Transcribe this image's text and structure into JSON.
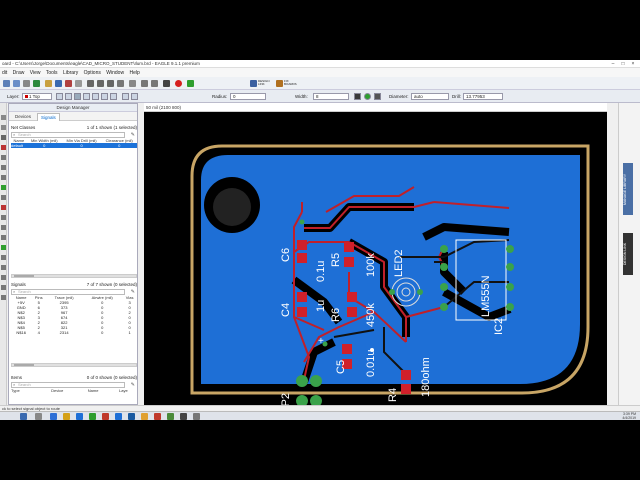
{
  "window": {
    "title": "oard - C:\\Users\\Jorge\\Documents\\eagle\\CAD_MICRO_STUDENT\\Ilum.brd - EAGLE 9.1.1 premium"
  },
  "menu": [
    "dit",
    "Draw",
    "View",
    "Tools",
    "Library",
    "Options",
    "Window",
    "Help"
  ],
  "toolbar": {
    "layer_label": "Layer:",
    "layer_value": "1 Top",
    "radius_label": "Radius:",
    "radius_value": "0",
    "width_label": "Width:",
    "width_value": "8",
    "diameter_label": "Diameter:",
    "diameter_value": "auto",
    "drill_label": "Drill:",
    "drill_value": "13.77953",
    "design_link_label": "DESIGN LINK",
    "fusion_label": "FIX BOARDS"
  },
  "coordinates": "50 mil (2100 800)",
  "design_manager": {
    "title": "Design Manager",
    "tabs": [
      "Devices",
      "Signals"
    ],
    "active_tab": "Signals",
    "net_classes": {
      "header": "Net Classes",
      "count": "1 of 1 shown (1 selected)",
      "search_placeholder": "Search",
      "columns": [
        "Name",
        "Min Width (mil)",
        "Min Via Drill (mil)",
        "Clearance (mil)"
      ],
      "rows": [
        [
          "default",
          "0",
          "0",
          "0"
        ]
      ]
    },
    "signals": {
      "header": "Signals",
      "count": "7 of 7 shown (0 selected)",
      "search_placeholder": "Search",
      "columns": [
        "Name",
        "Pins",
        "Trace (mil)",
        "Airwire (mil)",
        "Vias"
      ],
      "rows": [
        [
          "+5V",
          "5",
          "2395",
          "0",
          "3"
        ],
        [
          "GND",
          "6",
          "373",
          "0",
          "0"
        ],
        [
          "N$2",
          "2",
          "967",
          "0",
          "2"
        ],
        [
          "N$3",
          "3",
          "674",
          "0",
          "0"
        ],
        [
          "N$4",
          "2",
          "822",
          "0",
          "0"
        ],
        [
          "N$5",
          "2",
          "321",
          "0",
          "0"
        ],
        [
          "N$16",
          "4",
          "2314",
          "0",
          "1"
        ]
      ]
    },
    "items": {
      "header": "Items",
      "count": "0 of 0 shown (0 selected)",
      "search_placeholder": "Search",
      "columns": [
        "Type",
        "Device",
        "Name",
        "Laye"
      ]
    }
  },
  "right_panel": {
    "tabs": [
      "MANAGE LIBRARY",
      "DESIGN LINK"
    ]
  },
  "board": {
    "labels": {
      "c6": "C6",
      "c6_val": "0.1u",
      "r5": "R5",
      "r5_val": "100k",
      "led2": "LED2",
      "ic2_val": "LM555N",
      "ic2": "IC2",
      "c4": "C4",
      "c4_val": "1u",
      "r6": "R6",
      "r6_val": "450k",
      "c5": "C5",
      "c5_val": "0.01u",
      "r4": "R4",
      "r4_val": "180ohm",
      "jp2": "JP2",
      "plus": "+"
    }
  },
  "status": "ck to select signal object to route",
  "clock": {
    "time": "3:39 PM",
    "date": "4/4/2019"
  },
  "colors": {
    "board_blue": "#1e6fd6",
    "board_outline": "#c8a565",
    "trace_red": "#c0202a",
    "via_green": "#3aa24a",
    "silk_white": "#ffffff"
  }
}
